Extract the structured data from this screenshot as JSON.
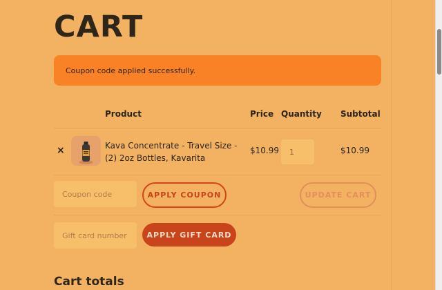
{
  "page": {
    "title": "CART"
  },
  "notice": {
    "text": "Coupon code applied successfully."
  },
  "table": {
    "headers": {
      "product": "Product",
      "price": "Price",
      "quantity": "Quantity",
      "subtotal": "Subtotal"
    },
    "items": [
      {
        "remove": "×",
        "name": "Kava Concentrate - Travel Size - (2) 2oz Bottles, Kavarita",
        "price": "$10.99",
        "quantity": "1",
        "subtotal": "$10.99",
        "image_icon": "product-bottle-icon"
      }
    ]
  },
  "coupon": {
    "placeholder": "Coupon code",
    "apply_label": "APPLY COUPON",
    "update_label": "UPDATE CART"
  },
  "gift_card": {
    "placeholder": "Gift card number",
    "apply_label": "APPLY GIFT CARD"
  },
  "totals": {
    "title": "Cart totals"
  },
  "colors": {
    "background": "#f3b262",
    "notice": "#f98226",
    "accent": "#c9431b",
    "text": "#2b2419"
  }
}
